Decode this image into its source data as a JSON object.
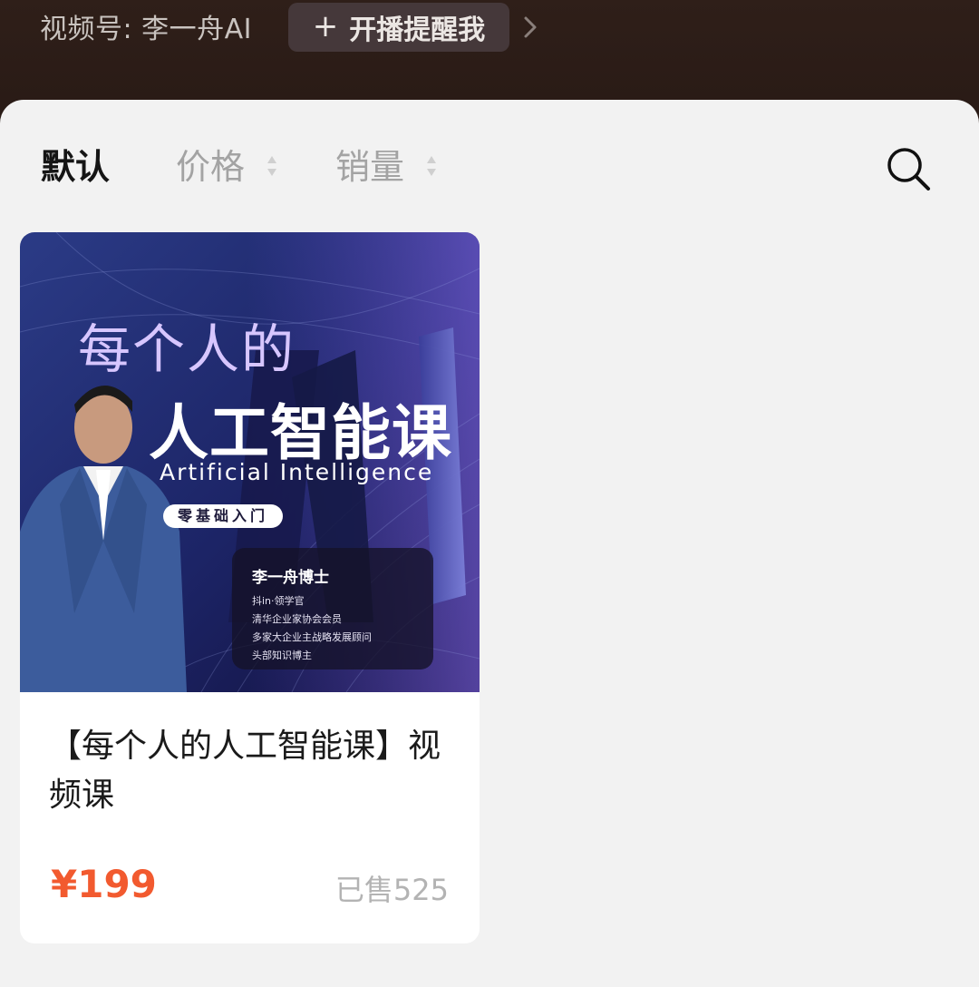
{
  "header": {
    "channel_label": "视频号: 李一舟AI",
    "remind_plus": "+",
    "remind_label": "开播提醒我"
  },
  "sort": {
    "default_label": "默认",
    "price_label": "价格",
    "sales_label": "销量"
  },
  "product": {
    "cover": {
      "line1": "每个人的",
      "line2": "人工智能课",
      "english": "Artificial  Intelligence",
      "badge": "零基础入门",
      "author": "李一舟博士",
      "info": [
        "抖in·领学官",
        "清华企业家协会会员",
        "多家大企业主战略发展顾问",
        "头部知识博主"
      ]
    },
    "title": "【每个人的人工智能课】视频课",
    "price": "¥199",
    "sold": "已售525"
  },
  "colors": {
    "price": "#f25a2f",
    "sheet_bg": "#f2f2f2",
    "top_bg": "#2a1c17"
  },
  "icons": {
    "search": "search-icon",
    "chevron": "chevron-right-icon",
    "sort_arrows": "sort-arrows-icon"
  }
}
